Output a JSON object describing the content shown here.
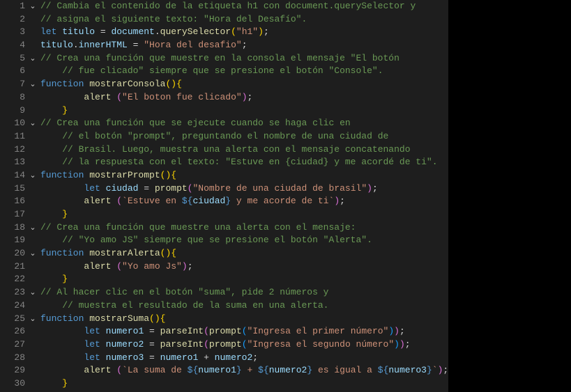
{
  "lines": [
    {
      "num": "1",
      "fold": true,
      "tokens": [
        [
          "comment",
          "// Cambia el contenido de la etiqueta h1 con document.querySelector y"
        ]
      ]
    },
    {
      "num": "2",
      "fold": false,
      "tokens": [
        [
          "comment",
          "// asigna el siguiente texto: \"Hora del Desafío\"."
        ]
      ]
    },
    {
      "num": "3",
      "fold": false,
      "tokens": [
        [
          "keyword",
          "let "
        ],
        [
          "var",
          "titulo"
        ],
        [
          "punct",
          " = "
        ],
        [
          "var",
          "document"
        ],
        [
          "punct",
          "."
        ],
        [
          "funcname",
          "querySelector"
        ],
        [
          "brace1",
          "("
        ],
        [
          "string",
          "\"h1\""
        ],
        [
          "brace1",
          ")"
        ],
        [
          "punct",
          ";"
        ]
      ]
    },
    {
      "num": "4",
      "fold": false,
      "tokens": [
        [
          "var",
          "titulo"
        ],
        [
          "punct",
          "."
        ],
        [
          "prop",
          "innerHTML"
        ],
        [
          "punct",
          " = "
        ],
        [
          "string",
          "\"Hora del desafio\""
        ],
        [
          "punct",
          ";"
        ]
      ]
    },
    {
      "num": "5",
      "fold": true,
      "tokens": [
        [
          "comment",
          "// Crea una función que muestre en la consola el mensaje \"El botón"
        ]
      ]
    },
    {
      "num": "6",
      "fold": false,
      "tokens": [
        [
          "comment",
          "// fue clicado\" siempre que se presione el botón \"Console\"."
        ]
      ],
      "indent": 1
    },
    {
      "num": "7",
      "fold": true,
      "tokens": [
        [
          "keyword",
          "function "
        ],
        [
          "funcname",
          "mostrarConsola"
        ],
        [
          "brace1",
          "("
        ],
        [
          "brace1",
          ")"
        ],
        [
          "brace1",
          "{"
        ]
      ]
    },
    {
      "num": "8",
      "fold": false,
      "tokens": [
        [
          "funcname",
          "alert "
        ],
        [
          "brace2",
          "("
        ],
        [
          "string",
          "\"El boton fue clicado\""
        ],
        [
          "brace2",
          ")"
        ],
        [
          "punct",
          ";"
        ]
      ],
      "indent": 2
    },
    {
      "num": "9",
      "fold": false,
      "tokens": [
        [
          "brace1",
          "}"
        ]
      ],
      "indent": 1
    },
    {
      "num": "10",
      "fold": true,
      "tokens": [
        [
          "comment",
          "// Crea una función que se ejecute cuando se haga clic en"
        ]
      ]
    },
    {
      "num": "11",
      "fold": false,
      "tokens": [
        [
          "comment",
          "// el botón \"prompt\", preguntando el nombre de una ciudad de"
        ]
      ],
      "indent": 1
    },
    {
      "num": "12",
      "fold": false,
      "tokens": [
        [
          "comment",
          "// Brasil. Luego, muestra una alerta con el mensaje concatenando"
        ]
      ],
      "indent": 1
    },
    {
      "num": "13",
      "fold": false,
      "tokens": [
        [
          "comment",
          "// la respuesta con el texto: \"Estuve en {ciudad} y me acordé de ti\"."
        ]
      ],
      "indent": 1
    },
    {
      "num": "14",
      "fold": true,
      "tokens": [
        [
          "keyword",
          "function "
        ],
        [
          "funcname",
          "mostrarPrompt"
        ],
        [
          "brace1",
          "("
        ],
        [
          "brace1",
          ")"
        ],
        [
          "brace1",
          "{"
        ]
      ]
    },
    {
      "num": "15",
      "fold": false,
      "tokens": [
        [
          "keyword",
          "let "
        ],
        [
          "var",
          "ciudad"
        ],
        [
          "punct",
          " = "
        ],
        [
          "funcname",
          "prompt"
        ],
        [
          "brace2",
          "("
        ],
        [
          "string",
          "\"Nombre de una ciudad de brasil\""
        ],
        [
          "brace2",
          ")"
        ],
        [
          "punct",
          ";"
        ]
      ],
      "indent": 2
    },
    {
      "num": "16",
      "fold": false,
      "tokens": [
        [
          "funcname",
          "alert "
        ],
        [
          "brace2",
          "("
        ],
        [
          "string",
          "`Estuve en "
        ],
        [
          "tplexpr",
          "${"
        ],
        [
          "tplvar",
          "ciudad"
        ],
        [
          "tplexpr",
          "}"
        ],
        [
          "string",
          " y me acorde de ti`"
        ],
        [
          "brace2",
          ")"
        ],
        [
          "punct",
          ";"
        ]
      ],
      "indent": 2
    },
    {
      "num": "17",
      "fold": false,
      "tokens": [
        [
          "brace1",
          "}"
        ]
      ],
      "indent": 1
    },
    {
      "num": "18",
      "fold": true,
      "tokens": [
        [
          "comment",
          "// Crea una función que muestre una alerta con el mensaje:"
        ]
      ]
    },
    {
      "num": "19",
      "fold": false,
      "tokens": [
        [
          "comment",
          "// \"Yo amo JS\" siempre que se presione el botón \"Alerta\"."
        ]
      ],
      "indent": 1
    },
    {
      "num": "20",
      "fold": true,
      "tokens": [
        [
          "keyword",
          "function "
        ],
        [
          "funcname",
          "mostrarAlerta"
        ],
        [
          "brace1",
          "("
        ],
        [
          "brace1",
          ")"
        ],
        [
          "brace1",
          "{"
        ]
      ]
    },
    {
      "num": "21",
      "fold": false,
      "tokens": [
        [
          "funcname",
          "alert "
        ],
        [
          "brace2",
          "("
        ],
        [
          "string",
          "\"Yo amo Js\""
        ],
        [
          "brace2",
          ")"
        ],
        [
          "punct",
          ";"
        ]
      ],
      "indent": 2
    },
    {
      "num": "22",
      "fold": false,
      "tokens": [
        [
          "brace1",
          "}"
        ]
      ],
      "indent": 1
    },
    {
      "num": "23",
      "fold": true,
      "tokens": [
        [
          "comment",
          "// Al hacer clic en el botón \"suma\", pide 2 números y"
        ]
      ]
    },
    {
      "num": "24",
      "fold": false,
      "tokens": [
        [
          "comment",
          "// muestra el resultado de la suma en una alerta."
        ]
      ],
      "indent": 1
    },
    {
      "num": "25",
      "fold": true,
      "tokens": [
        [
          "keyword",
          "function "
        ],
        [
          "funcname",
          "mostrarSuma"
        ],
        [
          "brace1",
          "("
        ],
        [
          "brace1",
          ")"
        ],
        [
          "brace1",
          "{"
        ]
      ]
    },
    {
      "num": "26",
      "fold": false,
      "tokens": [
        [
          "keyword",
          "let "
        ],
        [
          "var",
          "numero1"
        ],
        [
          "punct",
          " = "
        ],
        [
          "funcname",
          "parseInt"
        ],
        [
          "brace2",
          "("
        ],
        [
          "funcname",
          "prompt"
        ],
        [
          "brace3",
          "("
        ],
        [
          "string",
          "\"Ingresa el primer número\""
        ],
        [
          "brace3",
          ")"
        ],
        [
          "brace2",
          ")"
        ],
        [
          "punct",
          ";"
        ]
      ],
      "indent": 2
    },
    {
      "num": "27",
      "fold": false,
      "tokens": [
        [
          "keyword",
          "let "
        ],
        [
          "var",
          "numero2"
        ],
        [
          "punct",
          " = "
        ],
        [
          "funcname",
          "parseInt"
        ],
        [
          "brace2",
          "("
        ],
        [
          "funcname",
          "prompt"
        ],
        [
          "brace3",
          "("
        ],
        [
          "string",
          "\"Ingresa el segundo número\""
        ],
        [
          "brace3",
          ")"
        ],
        [
          "brace2",
          ")"
        ],
        [
          "punct",
          ";"
        ]
      ],
      "indent": 2
    },
    {
      "num": "28",
      "fold": false,
      "tokens": [
        [
          "keyword",
          "let "
        ],
        [
          "var",
          "numero3"
        ],
        [
          "punct",
          " = "
        ],
        [
          "var",
          "numero1"
        ],
        [
          "punct",
          " + "
        ],
        [
          "var",
          "numero2"
        ],
        [
          "punct",
          ";"
        ]
      ],
      "indent": 2
    },
    {
      "num": "29",
      "fold": false,
      "tokens": [
        [
          "funcname",
          "alert "
        ],
        [
          "brace2",
          "("
        ],
        [
          "string",
          "`La suma de "
        ],
        [
          "tplexpr",
          "${"
        ],
        [
          "tplvar",
          "numero1"
        ],
        [
          "tplexpr",
          "}"
        ],
        [
          "string",
          " + "
        ],
        [
          "tplexpr",
          "${"
        ],
        [
          "tplvar",
          "numero2"
        ],
        [
          "tplexpr",
          "}"
        ],
        [
          "string",
          " es igual a "
        ],
        [
          "tplexpr",
          "${"
        ],
        [
          "tplvar",
          "numero3"
        ],
        [
          "tplexpr",
          "}"
        ],
        [
          "string",
          "`"
        ],
        [
          "brace2",
          ")"
        ],
        [
          "punct",
          ";"
        ]
      ],
      "indent": 2
    },
    {
      "num": "30",
      "fold": false,
      "tokens": [
        [
          "brace1",
          "}"
        ]
      ],
      "indent": 1
    }
  ],
  "tokenClass": {
    "comment": "tok-comment",
    "keyword": "tok-keyword",
    "keyword2": "tok-keyword2",
    "var": "tok-var",
    "prop": "tok-prop",
    "funcname": "tok-funcname",
    "string": "tok-string",
    "tplexpr": "tok-tplexpr",
    "tplvar": "tok-tplvar",
    "punct": "tok-punct",
    "brace1": "tok-brace1",
    "brace2": "tok-brace2",
    "brace3": "tok-brace3",
    "num": "tok-num"
  },
  "chevGlyph": "⌄"
}
